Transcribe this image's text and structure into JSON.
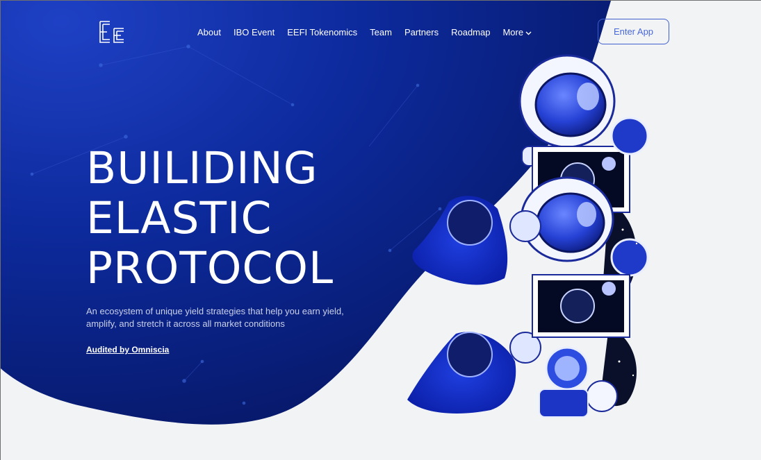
{
  "colors": {
    "page_bg": "#f2f3f5",
    "hero_blue_dark": "#07186d",
    "hero_blue": "#0d2a9c",
    "hero_blue_light": "#1e40c4",
    "accent": "#4868d6",
    "white": "#ffffff"
  },
  "header": {
    "logo_icon": "ee-logo-icon",
    "nav": [
      {
        "label": "About"
      },
      {
        "label": "IBO Event"
      },
      {
        "label": "EEFI Tokenomics"
      },
      {
        "label": "Team"
      },
      {
        "label": "Partners"
      },
      {
        "label": "Roadmap"
      },
      {
        "label": "More",
        "icon": "chevron-down-icon"
      }
    ],
    "enter_app_label": "Enter App"
  },
  "hero": {
    "title_lines": [
      "BUILIDING",
      "ELASTIC",
      "PROTOCOL"
    ],
    "subtitle": "An ecosystem of unique yield strategies that help you earn yield, amplify, and stretch it across all market conditions",
    "audited_link": "Audited by Omniscia",
    "illustration_icon": "astronaut-collage-illustration"
  }
}
